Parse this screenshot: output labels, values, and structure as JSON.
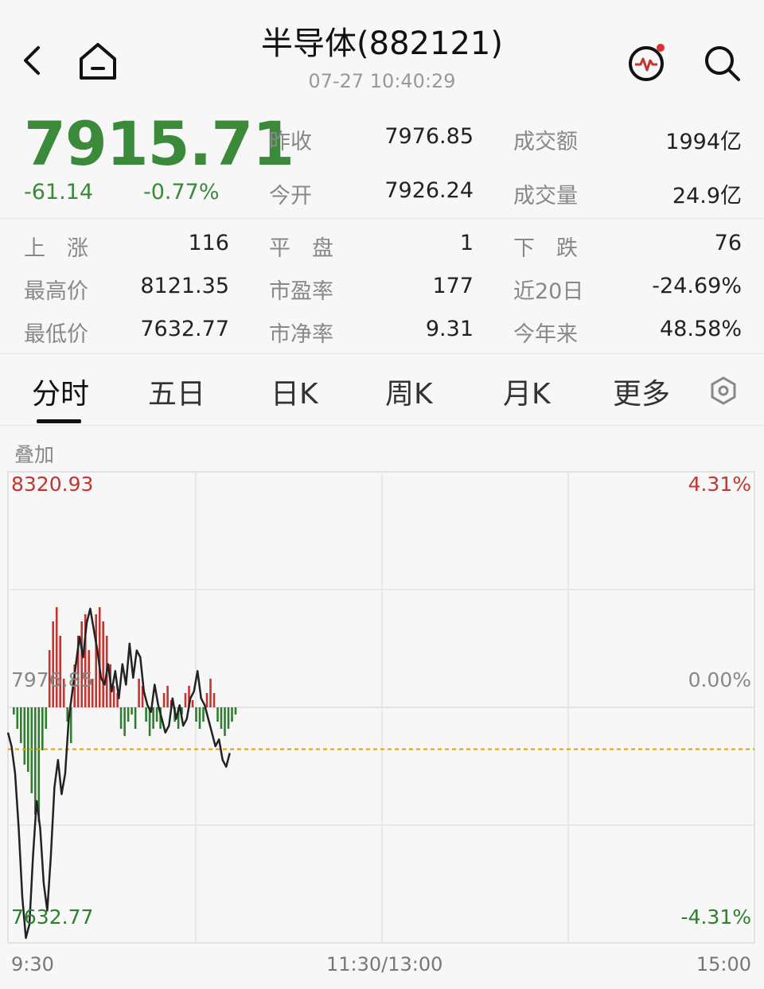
{
  "header": {
    "title": "半导体(882121)",
    "time": "07-27 10:40:29"
  },
  "quote": {
    "price": "7915.71",
    "change": "-61.14",
    "change_pct": "-0.77%"
  },
  "stats_top": [
    {
      "label": "昨收",
      "value": "7976.85"
    },
    {
      "label": "成交额",
      "value": "1994亿"
    },
    {
      "label": "今开",
      "value": "7926.24"
    },
    {
      "label": "成交量",
      "value": "24.9亿"
    }
  ],
  "stats_grid": [
    {
      "label": "上　涨",
      "value": "116"
    },
    {
      "label": "平　盘",
      "value": "1"
    },
    {
      "label": "下　跌",
      "value": "76"
    },
    {
      "label": "最高价",
      "value": "8121.35"
    },
    {
      "label": "市盈率",
      "value": "177"
    },
    {
      "label": "近20日",
      "value": "-24.69%"
    },
    {
      "label": "最低价",
      "value": "7632.77"
    },
    {
      "label": "市净率",
      "value": "9.31"
    },
    {
      "label": "今年来",
      "value": "48.58%"
    }
  ],
  "tabs": [
    "分时",
    "五日",
    "日K",
    "周K",
    "月K",
    "更多"
  ],
  "chart": {
    "overlay_label": "叠加",
    "top_price": "8320.93",
    "mid_price": "7976.85",
    "bottom_price": "7632.77",
    "top_pct": "4.31%",
    "mid_pct": "0.00%",
    "bottom_pct": "-4.31%",
    "time_start": "9:30",
    "time_mid": "11:30/13:00",
    "time_end": "15:00"
  },
  "colors": {
    "up": "#c23531",
    "down": "#2f7d2f",
    "avg": "#e8a000"
  },
  "chart_data": {
    "type": "line",
    "ylim": [
      7632.77,
      8320.93
    ],
    "baseline": 7976.85,
    "avg_line": 7915.71,
    "price": [
      7940,
      7920,
      7880,
      7800,
      7700,
      7640,
      7660,
      7760,
      7840,
      7800,
      7720,
      7680,
      7760,
      7860,
      7900,
      7850,
      7880,
      7960,
      8000,
      8040,
      8080,
      8050,
      8100,
      8121,
      8090,
      8060,
      8020,
      8010,
      8040,
      8000,
      8030,
      7990,
      8040,
      8010,
      8070,
      8020,
      8060,
      8050,
      8000,
      7980,
      7970,
      8010,
      7980,
      7960,
      7940,
      7950,
      7990,
      7960,
      7980,
      7950,
      7960,
      7990,
      8000,
      8030,
      7990,
      7980,
      7960,
      7940,
      7920,
      7930,
      7900,
      7890,
      7910
    ],
    "bars": [
      -1,
      -3,
      -5,
      -8,
      -9,
      -12,
      -15,
      -16,
      -6,
      -3,
      8,
      12,
      14,
      10,
      4,
      -2,
      -5,
      6,
      10,
      12,
      13,
      8,
      4,
      13,
      14,
      12,
      10,
      6,
      3,
      2,
      -3,
      -4,
      -2,
      -1,
      -3,
      4,
      3,
      -2,
      -4,
      -3,
      -2,
      -3,
      2,
      3,
      1,
      -2,
      -3,
      -1,
      2,
      3,
      1,
      -2,
      -3,
      -2,
      2,
      4,
      2,
      -2,
      -3,
      -4,
      -3,
      -2,
      -1
    ]
  }
}
